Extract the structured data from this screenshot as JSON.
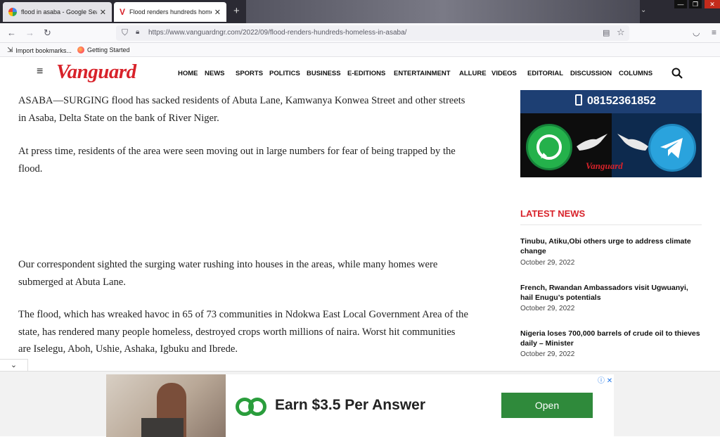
{
  "browser": {
    "tabs": [
      {
        "title": "flood in asaba - Google Search",
        "active": false
      },
      {
        "title": "Flood renders hundreds homele",
        "active": true
      }
    ],
    "new_tab_glyph": "+",
    "url": "https://www.vanguardngr.com/2022/09/flood-renders-hundreds-homeless-in-asaba/",
    "bookmarks": [
      {
        "label": "Import bookmarks...",
        "icon": "import-icon"
      },
      {
        "label": "Getting Started",
        "icon": "firefox-icon"
      }
    ]
  },
  "site": {
    "logo": "Vanguard",
    "menu": [
      "HOME",
      "NEWS",
      "SPORTS",
      "POLITICS",
      "BUSINESS",
      "E-EDITIONS",
      "ENTERTAINMENT",
      "ALLURE",
      "VIDEOS",
      "EDITORIAL",
      "DISCUSSION",
      "COLUMNS"
    ],
    "brand_color": "#d8222a"
  },
  "article": {
    "paragraphs": [
      "ASABA—SURGING flood has sacked residents of Abuta Lane, Kamwanya Konwea Street and other streets in Asaba, Delta State on the bank of River Niger.",
      "At press time, residents of the area were seen moving out in large numbers for fear of being trapped by the flood.",
      "Our correspondent sighted the surging water rushing into houses in the areas, while many homes were submerged at Abuta Lane.",
      "The flood, which has wreaked havoc in 65 of 73 communities in Ndokwa East Local Government Area of the state, has rendered many people homeless, destroyed crops worth millions of naira. Worst hit communities are Iselegu, Aboh, Ushie, Ashaka, Igbuku and Ibrede."
    ]
  },
  "sidebar": {
    "promo": {
      "phone": "08152361852",
      "brand": "Vanguard"
    },
    "latest_heading": "LATEST NEWS",
    "news": [
      {
        "title": " Tinubu, Atiku,Obi others urge to address climate change",
        "date": "October 29, 2022"
      },
      {
        "title": "French, Rwandan Ambassadors visit Ugwuanyi, hail Enugu’s potentials",
        "date": "October 29, 2022"
      },
      {
        "title": "Nigeria loses 700,000 barrels of crude oil to thieves daily – Minister",
        "date": "October 29, 2022"
      }
    ]
  },
  "ad": {
    "headline": "Earn $3.5 Per Answer",
    "button": "Open",
    "accent": "#2f8a3b"
  }
}
